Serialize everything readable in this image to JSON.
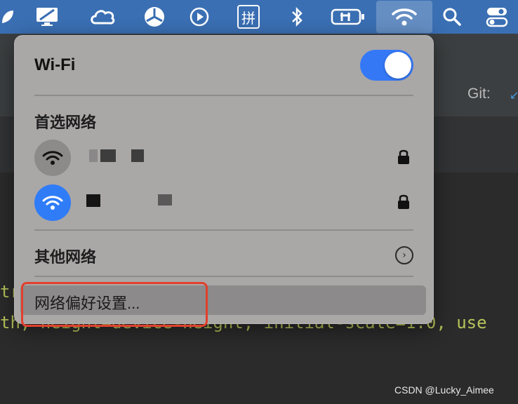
{
  "menubar": {
    "icons": [
      "leaf-icon",
      "display-icon",
      "creative-cloud-icon",
      "mesh-icon",
      "play-icon",
      "pinyin-input-icon",
      "bluetooth-icon",
      "battery-charging-icon",
      "wifi-icon",
      "search-icon",
      "control-center-icon"
    ],
    "pinyin_glyph": "拼"
  },
  "background": {
    "git_label": "Git:",
    "code_line_1": "tr",
    "code_line_2": "th, height=device-height, initial-scale=1.0, use"
  },
  "wifi_menu": {
    "title": "Wi-Fi",
    "toggle_on": true,
    "preferred_label": "首选网络",
    "networks": [
      {
        "secured": true,
        "connected": false
      },
      {
        "secured": true,
        "connected": true
      }
    ],
    "other_label": "其他网络",
    "prefs_label": "网络偏好设置..."
  },
  "watermark": "CSDN @Lucky_Aimee",
  "colors": {
    "accent": "#3478f6",
    "highlight": "#e2402e",
    "menubar": "#3a6fb3"
  }
}
